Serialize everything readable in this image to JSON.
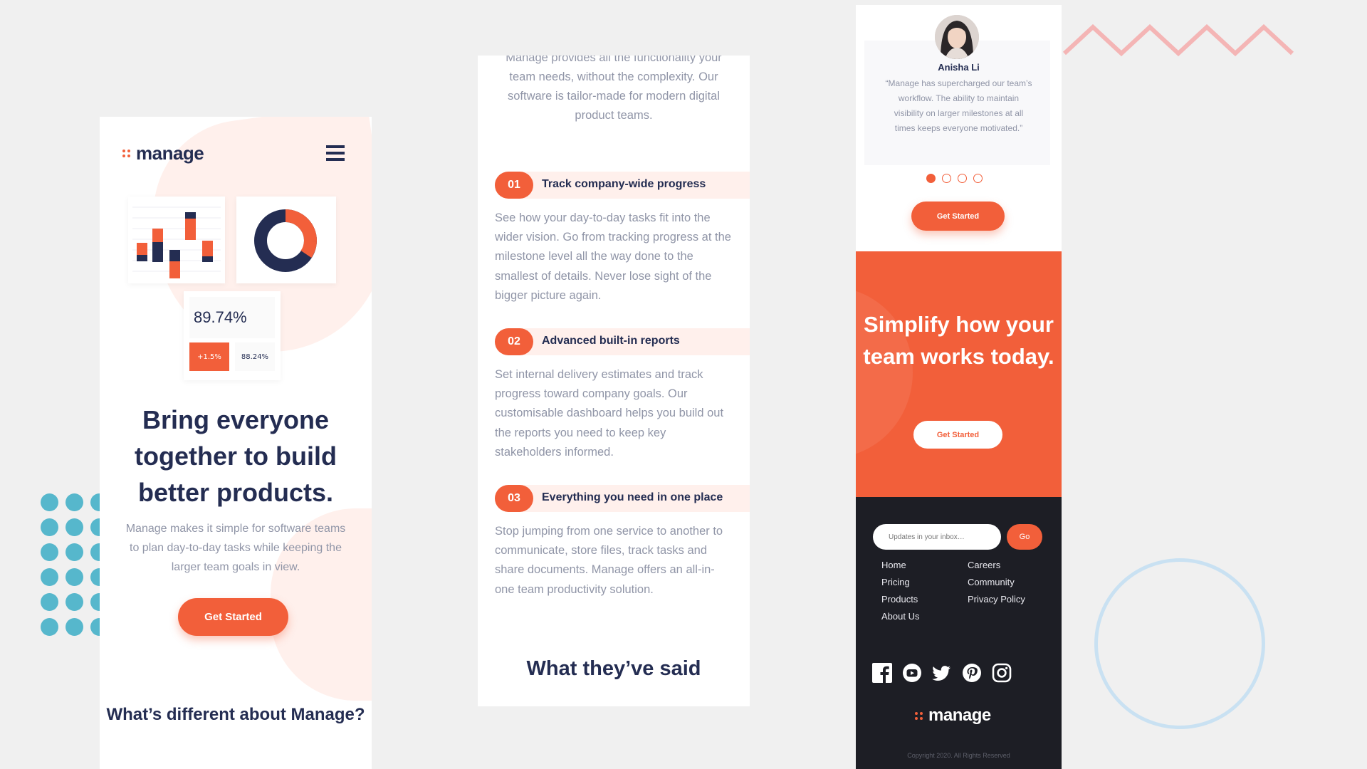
{
  "colors": {
    "accent": "#f25f3a",
    "navy": "#242d52",
    "muted": "#9095a7",
    "tint": "#fff0ec",
    "footer": "#1d1e25",
    "decoration_teal": "#56b7cc",
    "decoration_pink": "#f4b5b5",
    "decoration_blue": "#c9e1f2"
  },
  "brand": {
    "logo_text": "manage"
  },
  "hero": {
    "stat_value": "89.74%",
    "stat_chip_change": "+1.5%",
    "stat_chip_value": "88.24%",
    "title": "Bring everyone together to build better products.",
    "description": "Manage makes it simple for software teams to plan day-to-day tasks while keeping the larger team goals in view.",
    "cta_label": "Get Started"
  },
  "different": {
    "title": "What’s different about Manage?",
    "intro": "Manage provides all the functionality your team needs, without the complexity. Our software is tailor-made for modern digital product teams."
  },
  "features": [
    {
      "number": "01",
      "title": "Track company-wide progress",
      "text": "See how your day-to-day tasks fit into the wider vision. Go from tracking progress at the milestone level all the way done to the smallest of details. Never lose sight of the bigger picture again."
    },
    {
      "number": "02",
      "title": "Advanced built-in reports",
      "text": "Set internal delivery estimates and track progress toward company goals. Our customisable dashboard helps you build out the reports you need to keep key stakeholders informed."
    },
    {
      "number": "03",
      "title": "Everything you need in one place",
      "text": "Stop jumping from one service to another to communicate, store files, track tasks and share documents. Manage offers an all-in-one team productivity solution."
    }
  ],
  "testimonials": {
    "title": "What they’ve said",
    "name": "Anisha Li",
    "quote": "“Manage has supercharged our team’s workflow. The ability to maintain visibility on larger milestones at all times keeps everyone motivated.”",
    "active_index": 0,
    "total": 4,
    "cta_label": "Get Started"
  },
  "cta_banner": {
    "title": "Simplify how your team works today.",
    "button_label": "Get Started"
  },
  "footer": {
    "newsletter_placeholder": "Updates in your inbox…",
    "go_label": "Go",
    "links_col1": [
      "Home",
      "Pricing",
      "Products",
      "About Us"
    ],
    "links_col2": [
      "Careers",
      "Community",
      "Privacy Policy"
    ],
    "social_icons": [
      "facebook-icon",
      "youtube-icon",
      "twitter-icon",
      "pinterest-icon",
      "instagram-icon"
    ],
    "copyright": "Copyright 2020. All Rights Reserved"
  }
}
